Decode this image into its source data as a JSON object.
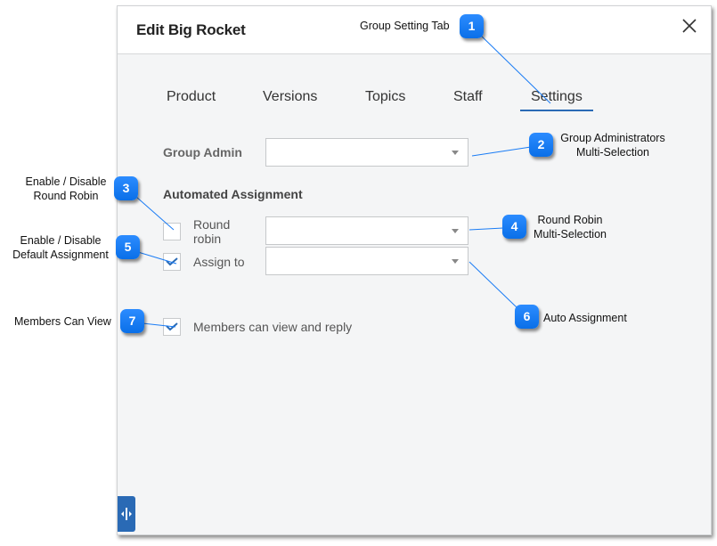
{
  "dialog": {
    "title": "Edit Big Rocket",
    "close_icon": "close-icon",
    "tabs": [
      {
        "label": "Product",
        "active": false
      },
      {
        "label": "Versions",
        "active": false
      },
      {
        "label": "Topics",
        "active": false
      },
      {
        "label": "Staff",
        "active": false
      },
      {
        "label": "Settings",
        "active": true
      }
    ],
    "group_admin": {
      "label": "Group Admin",
      "value": ""
    },
    "automated_assignment": {
      "title": "Automated Assignment",
      "round_robin": {
        "label_line1": "Round",
        "label_line2": "robin",
        "checked": false,
        "value": ""
      },
      "assign_to": {
        "label": "Assign to",
        "checked": true,
        "value": ""
      }
    },
    "members_can_view": {
      "label": "Members can view and reply",
      "checked": true
    },
    "resize_icon": "resize-horizontal-icon"
  },
  "annotations": [
    {
      "number": "1",
      "text": "Group Setting Tab"
    },
    {
      "number": "2",
      "text_line1": "Group Administrators",
      "text_line2": "Multi-Selection"
    },
    {
      "number": "3",
      "text_line1": "Enable / Disable",
      "text_line2": "Round Robin"
    },
    {
      "number": "4",
      "text_line1": "Round Robin",
      "text_line2": "Multi-Selection"
    },
    {
      "number": "5",
      "text_line1": "Enable / Disable",
      "text_line2": "Default Assignment"
    },
    {
      "number": "6",
      "text": "Auto Assignment"
    },
    {
      "number": "7",
      "text": "Members Can View"
    }
  ],
  "colors": {
    "accent": "#2a6ab5",
    "callout": "#1a7cf5",
    "check": "#2a6ab5"
  }
}
